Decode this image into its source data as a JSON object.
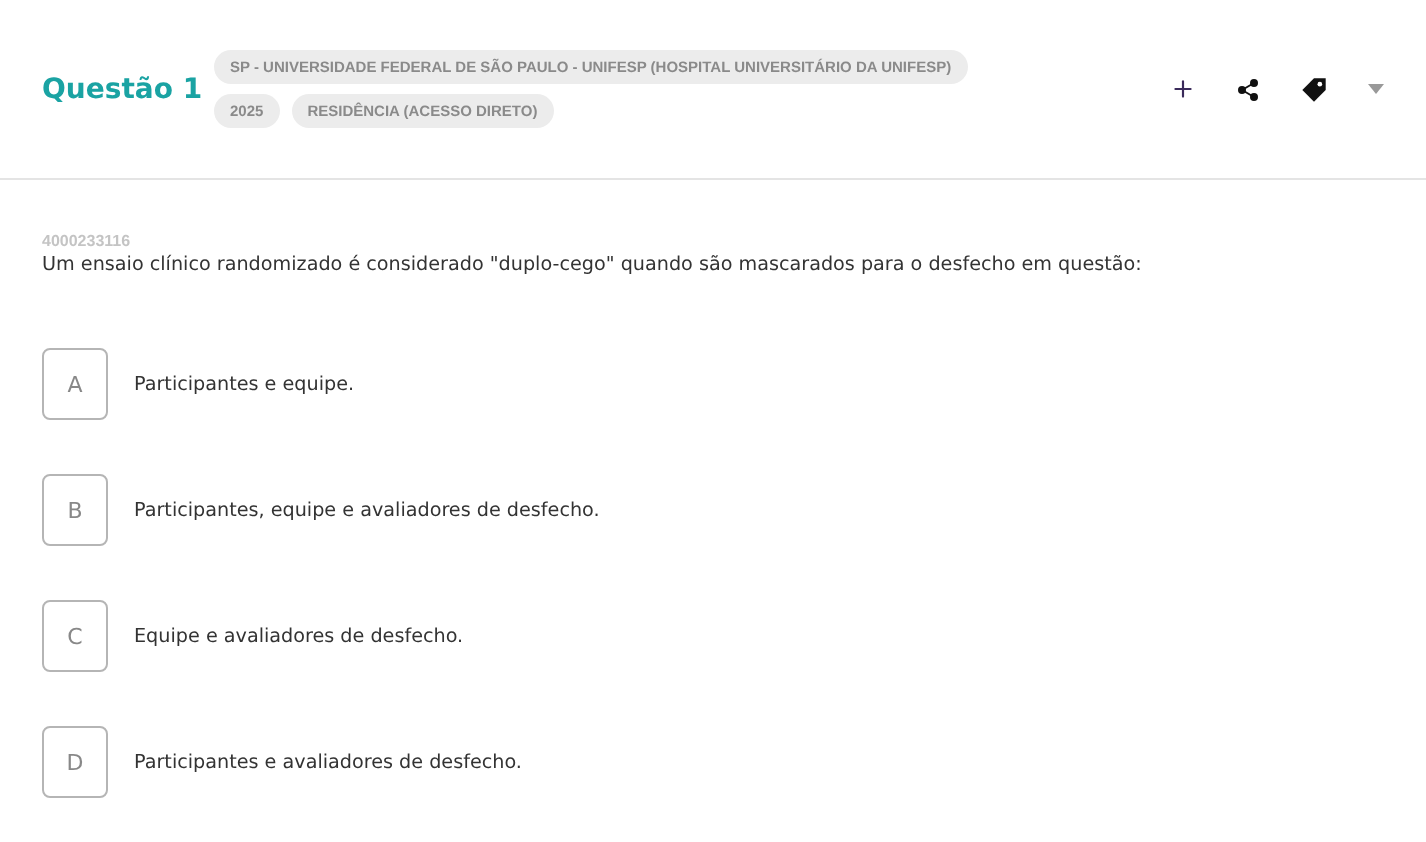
{
  "header": {
    "title": "Questão 1",
    "tags": [
      [
        "SP - UNIVERSIDADE FEDERAL DE SÃO PAULO - UNIFESP (HOSPITAL UNIVERSITÁRIO DA UNIFESP)"
      ],
      [
        "2025",
        "RESIDÊNCIA (ACESSO DIRETO)"
      ]
    ]
  },
  "question": {
    "id": "4000233116",
    "text": "Um ensaio clínico randomizado é considerado \"duplo-cego\" quando são mascarados para o desfecho em questão:"
  },
  "options": [
    {
      "letter": "A",
      "text": "Participantes e equipe.",
      "selected": false
    },
    {
      "letter": "B",
      "text": "Participantes, equipe e avaliadores de desfecho.",
      "selected": false
    },
    {
      "letter": "C",
      "text": "Equipe e avaliadores de desfecho.",
      "selected": false
    },
    {
      "letter": "D",
      "text": "Participantes e avaliadores de desfecho.",
      "selected": false
    }
  ]
}
